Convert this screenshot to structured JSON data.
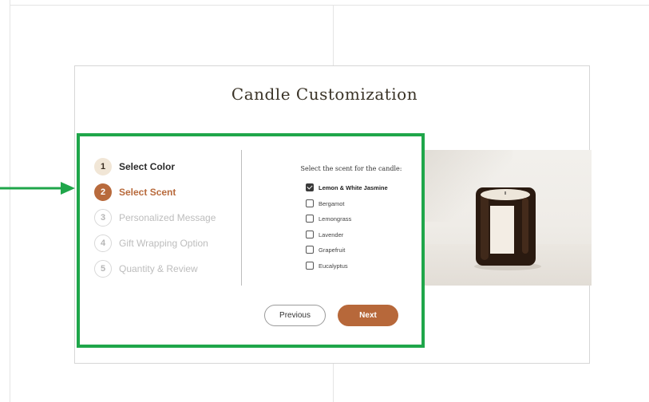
{
  "page": {
    "title": "Candle Customization"
  },
  "steps": [
    {
      "number": "1",
      "label": "Select Color",
      "state": "completed"
    },
    {
      "number": "2",
      "label": "Select Scent",
      "state": "active"
    },
    {
      "number": "3",
      "label": "Personalized Message",
      "state": "upcoming"
    },
    {
      "number": "4",
      "label": "Gift Wrapping Option",
      "state": "upcoming"
    },
    {
      "number": "5",
      "label": "Quantity & Review",
      "state": "upcoming"
    }
  ],
  "scent": {
    "prompt": "Select the scent for the candle:",
    "options": [
      {
        "label": "Lemon & White Jasmine",
        "checked": true
      },
      {
        "label": "Bergamot",
        "checked": false
      },
      {
        "label": "Lemongrass",
        "checked": false
      },
      {
        "label": "Lavender",
        "checked": false
      },
      {
        "label": "Grapefruit",
        "checked": false
      },
      {
        "label": "Eucalyptus",
        "checked": false
      }
    ]
  },
  "buttons": {
    "previous": "Previous",
    "next": "Next"
  },
  "colors": {
    "accent": "#b86a3c",
    "highlight_border": "#1fa64a",
    "annotation_arrow": "#1fa64a",
    "completed_step_bg": "#f1e6d6"
  },
  "icons": {
    "annotation": "right-arrow-icon",
    "checkbox_checked": "checkmark-icon"
  }
}
